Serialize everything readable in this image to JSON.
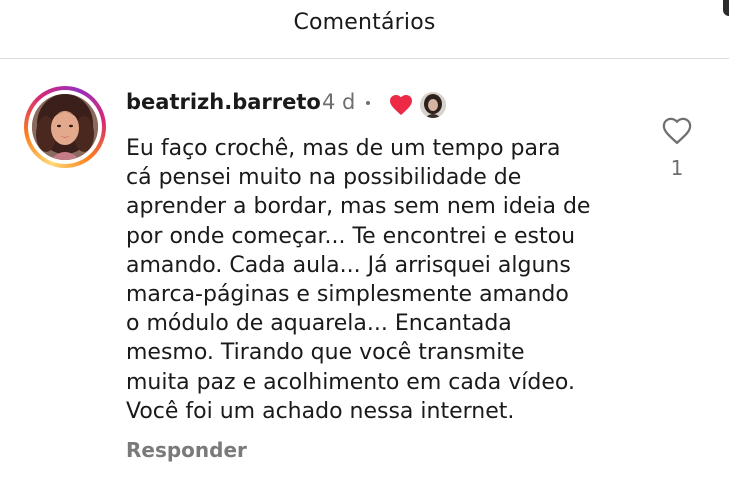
{
  "header": {
    "title": "Comentários"
  },
  "comment": {
    "username": "beatrizh.barreto",
    "time": "4 d",
    "lines": [
      "Eu faço crochê, mas de um tempo para",
      "cá pensei muito na possibilidade de",
      "aprender a bordar, mas sem nem ideia de",
      "por onde começar... Te encontrei e estou",
      "amando. Cada aula... Já arrisquei alguns",
      "marca-páginas e simplesmente amando",
      "o módulo de aquarela... Encantada",
      "mesmo. Tirando que você transmite",
      "muita paz e acolhimento em cada vídeo.",
      "Você foi um achado nessa internet."
    ],
    "reply_label": "Responder",
    "like_count": "1"
  },
  "icons": {
    "creator_liked": "heart-filled-icon",
    "like": "heart-outline-icon"
  },
  "colors": {
    "liked_heart": "#ed2a46",
    "meta_text": "#6f6f6f",
    "reply_text": "#7a7a7a",
    "story_ring_start": "#feda75",
    "story_ring_end": "#d62976"
  }
}
